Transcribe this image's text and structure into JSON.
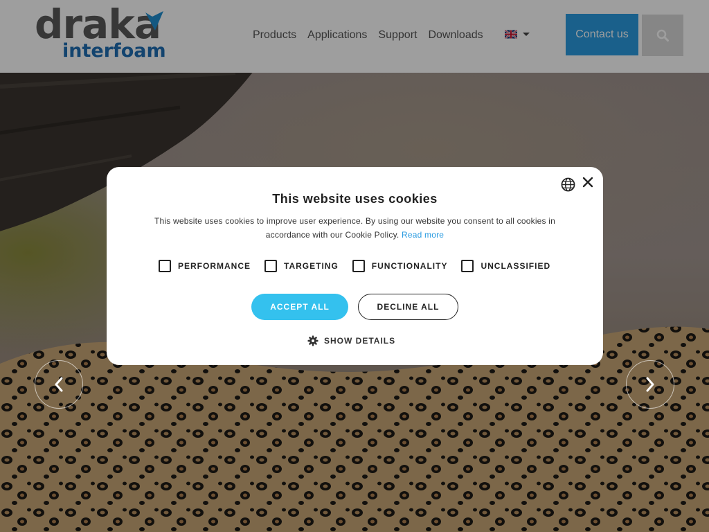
{
  "colors": {
    "brand_gray": "#5a5a5a",
    "brand_blue": "#1f6fb3",
    "accent": "#2a9be0",
    "accept_button": "#34c1ee",
    "overlay": "rgba(0,0,0,0.38)"
  },
  "header": {
    "logo": {
      "word_top": "draka",
      "word_bottom": "interfoam",
      "icon": "checkmark-icon"
    },
    "nav": [
      {
        "label": "Products"
      },
      {
        "label": "Applications"
      },
      {
        "label": "Support"
      },
      {
        "label": "Downloads"
      }
    ],
    "language": {
      "icon": "uk-flag-icon",
      "caret_icon": "caret-down-icon"
    },
    "contact_label": "Contact us",
    "search_icon": "search-icon"
  },
  "hero": {
    "prev_icon": "chevron-left-icon",
    "next_icon": "chevron-right-icon"
  },
  "cookie_modal": {
    "title": "This website uses cookies",
    "text": "This website uses cookies to improve user experience. By using our website you consent to all cookies in accordance with our Cookie Policy.",
    "read_more": "Read more",
    "checkboxes": [
      {
        "label": "PERFORMANCE",
        "checked": false
      },
      {
        "label": "TARGETING",
        "checked": false
      },
      {
        "label": "FUNCTIONALITY",
        "checked": false
      },
      {
        "label": "UNCLASSIFIED",
        "checked": false
      }
    ],
    "accept_label": "ACCEPT ALL",
    "decline_label": "DECLINE ALL",
    "details_label": "SHOW DETAILS",
    "language_icon": "globe-icon",
    "close_icon": "close-icon",
    "details_icon": "gear-icon"
  }
}
